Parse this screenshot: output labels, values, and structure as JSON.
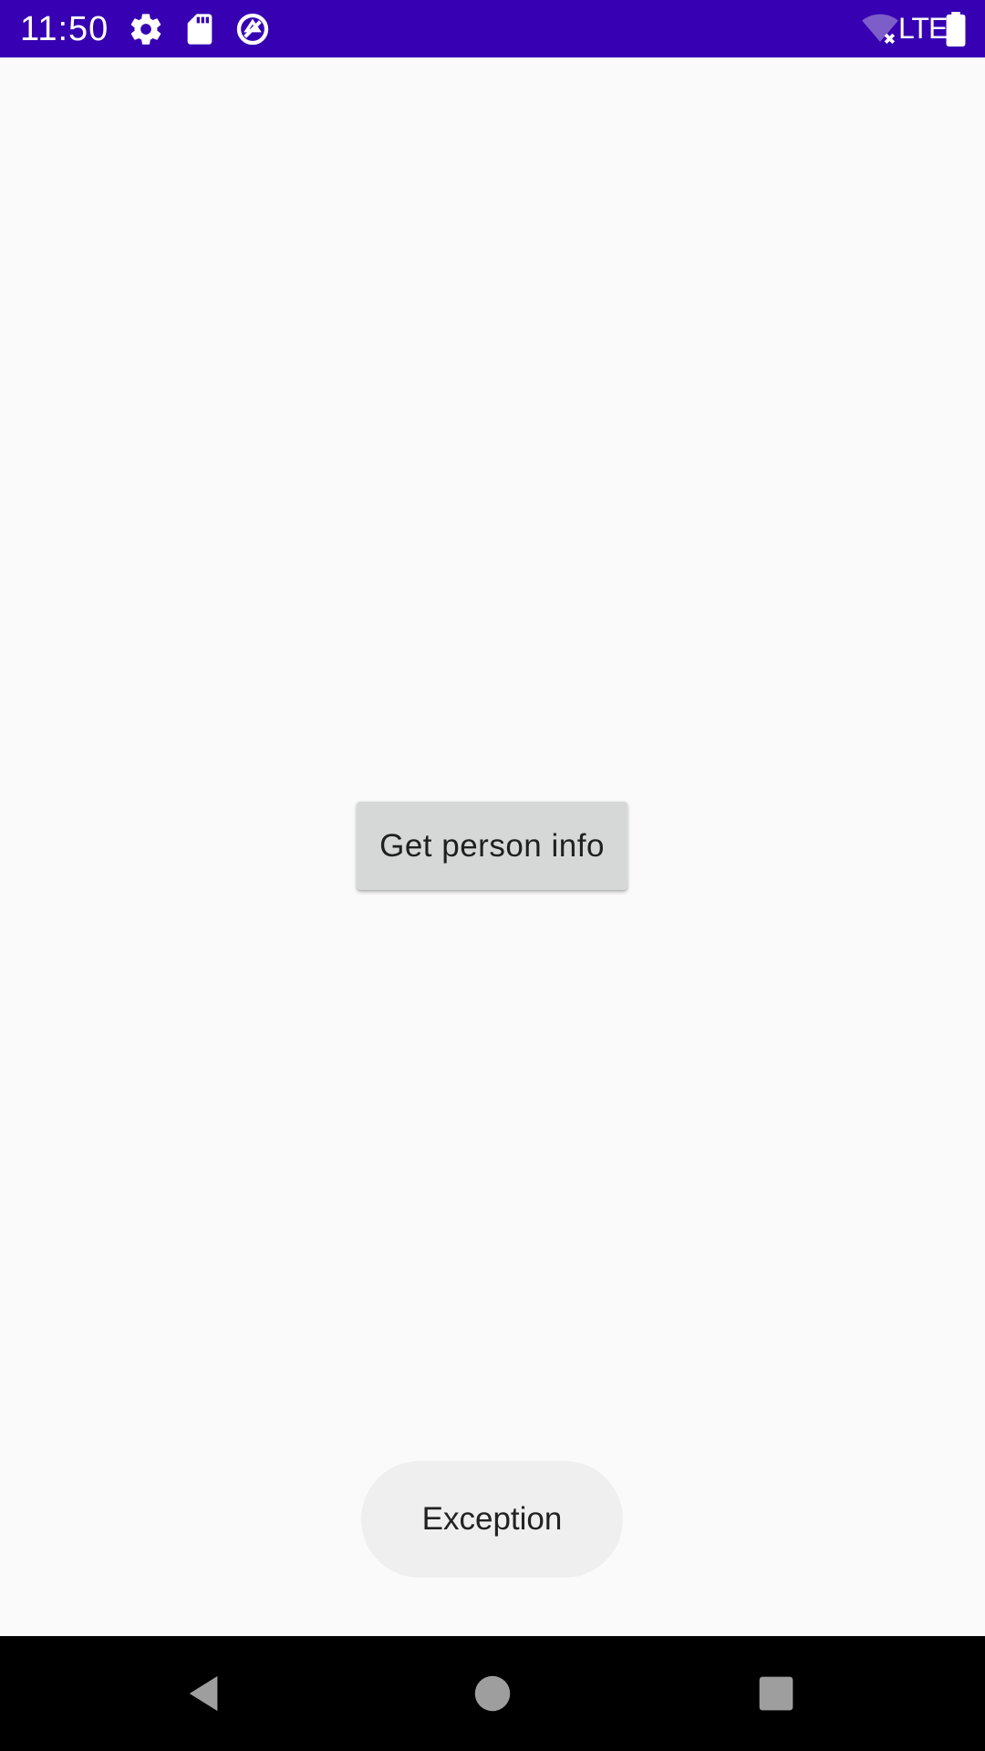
{
  "status_bar": {
    "time": "11:50",
    "icons": [
      "gear-icon",
      "sd-card-icon",
      "data-saver-icon",
      "wifi-off-icon",
      "battery-icon"
    ],
    "network_label": "LTE",
    "background": "#3700b3"
  },
  "main": {
    "button_label": "Get person info",
    "button_color": "#d6d7d7"
  },
  "toast": {
    "message": "Exception"
  },
  "nav_bar": {
    "buttons": [
      "back",
      "home",
      "recents"
    ]
  }
}
